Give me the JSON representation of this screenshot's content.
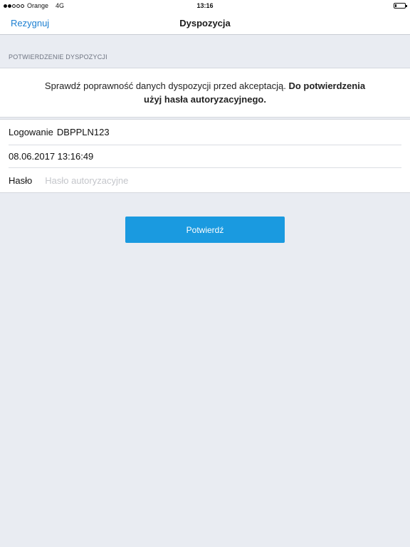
{
  "status_bar": {
    "carrier": "Orange",
    "network": "4G",
    "time": "13:16",
    "battery_level": 0.15
  },
  "nav": {
    "back_label": "Rezygnuj",
    "title": "Dyspozycja",
    "accent_color": "#1c7fd1"
  },
  "section": {
    "header": "POTWIERDZENIE DYSPOZYCJI"
  },
  "info": {
    "text_normal": "Sprawdź poprawność danych dyspozycji przed akceptacją.",
    "text_bold": "Do potwierdzenia użyj hasła autoryzacyjnego."
  },
  "form": {
    "login_label": "Logowanie",
    "login_value": "DBPPLN123",
    "datetime": "08.06.2017 13:16:49",
    "password_label": "Hasło",
    "password_placeholder": "Hasło autoryzacyjne",
    "password_value": ""
  },
  "actions": {
    "confirm_label": "Potwierdź",
    "confirm_color": "#1a9ae0"
  },
  "icons": {
    "signal": "signal-strength-icon",
    "battery": "battery-icon"
  }
}
